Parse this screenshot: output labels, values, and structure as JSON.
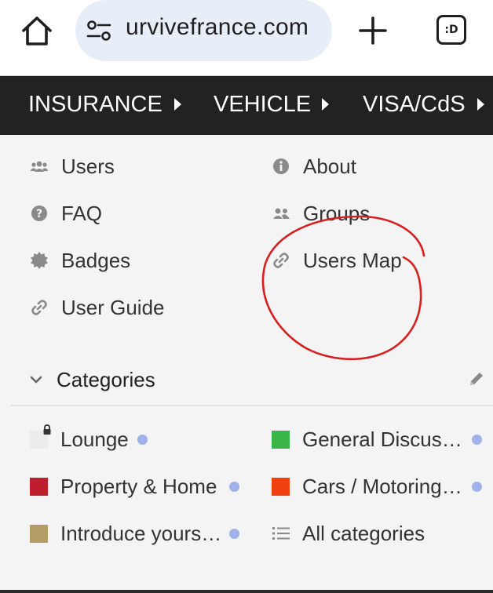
{
  "browser": {
    "url": "urvivefrance.com",
    "tabs_label": ":D"
  },
  "nav": {
    "items": [
      {
        "label": "INSURANCE"
      },
      {
        "label": "VEHICLE"
      },
      {
        "label": "VISA/CdS"
      }
    ]
  },
  "links": {
    "users": "Users",
    "about": "About",
    "faq": "FAQ",
    "groups": "Groups",
    "badges": "Badges",
    "users_map": "Users Map",
    "user_guide": "User Guide"
  },
  "categories": {
    "title": "Categories",
    "items": [
      {
        "label": "Lounge",
        "color": "#ececec",
        "locked": true,
        "new": true
      },
      {
        "label": "General Discus…",
        "color": "#3ab54a",
        "new": true
      },
      {
        "label": "Property & Home",
        "color": "#bf1e2e",
        "new": true
      },
      {
        "label": "Cars / Motoring…",
        "color": "#f1410f",
        "new": true
      },
      {
        "label": "Introduce yours…",
        "color": "#b49c65",
        "new": true
      }
    ],
    "all_label": "All categories"
  },
  "colors": {
    "nav_bg": "#222222",
    "panel_bg": "#f4f4f4",
    "url_pill": "#e8eef8",
    "new_dot": "#9fb3ea",
    "annotation": "#d62020"
  }
}
